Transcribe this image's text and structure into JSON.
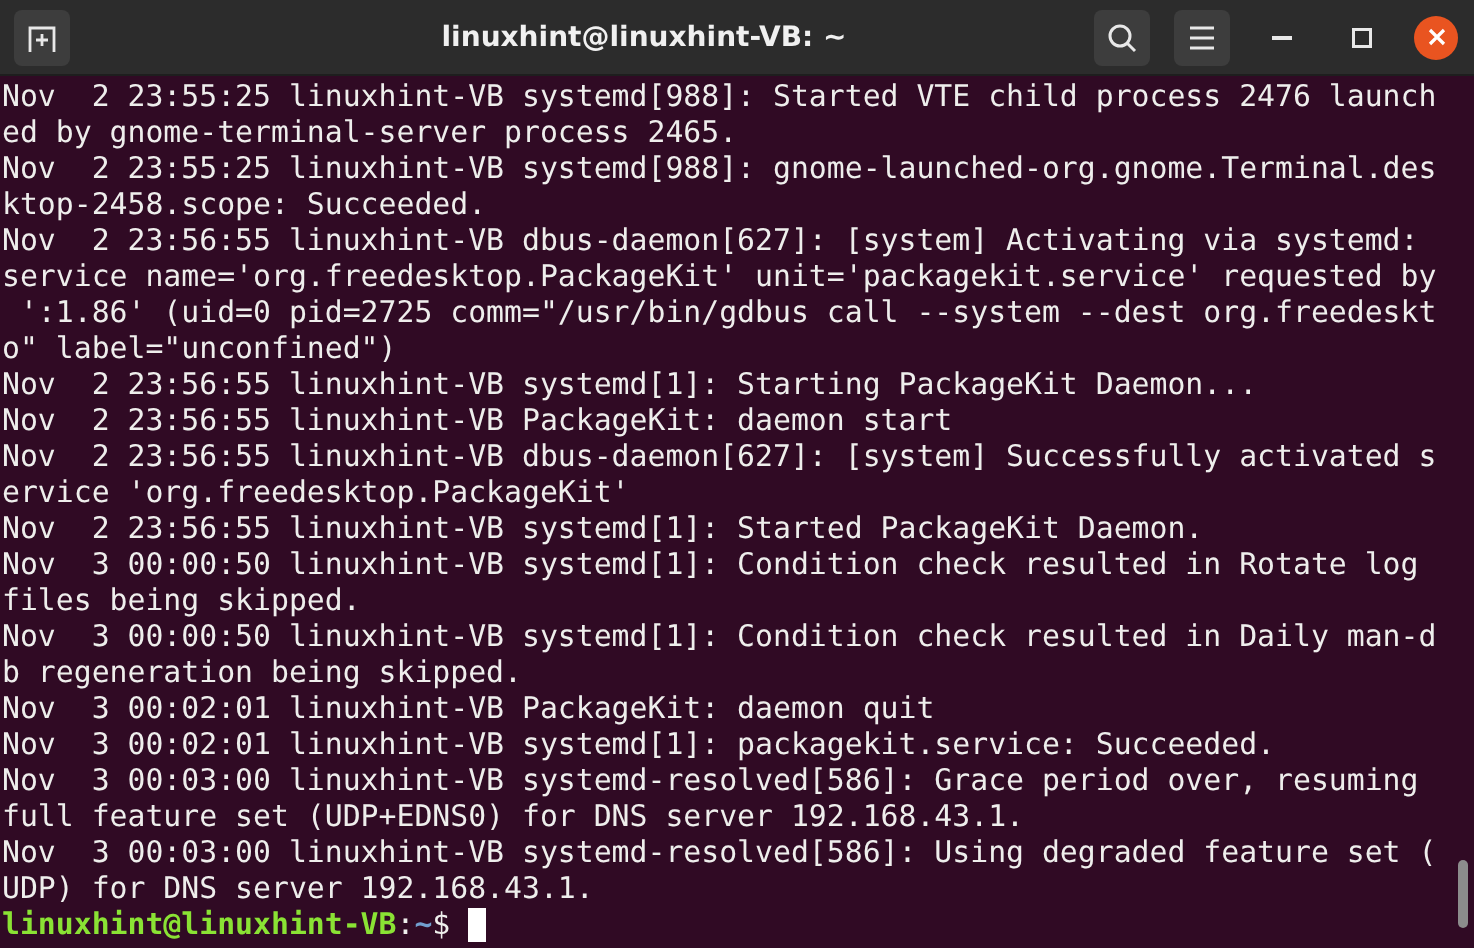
{
  "window": {
    "title": "linuxhint@linuxhint-VB: ~"
  },
  "output_lines": [
    "Nov  2 23:55:25 linuxhint-VB systemd[988]: Started VTE child process 2476 launch",
    "ed by gnome-terminal-server process 2465.",
    "Nov  2 23:55:25 linuxhint-VB systemd[988]: gnome-launched-org.gnome.Terminal.des",
    "ktop-2458.scope: Succeeded.",
    "Nov  2 23:56:55 linuxhint-VB dbus-daemon[627]: [system] Activating via systemd:",
    "service name='org.freedesktop.PackageKit' unit='packagekit.service' requested by",
    " ':1.86' (uid=0 pid=2725 comm=\"/usr/bin/gdbus call --system --dest org.freedeskt",
    "o\" label=\"unconfined\")",
    "Nov  2 23:56:55 linuxhint-VB systemd[1]: Starting PackageKit Daemon...",
    "Nov  2 23:56:55 linuxhint-VB PackageKit: daemon start",
    "Nov  2 23:56:55 linuxhint-VB dbus-daemon[627]: [system] Successfully activated s",
    "ervice 'org.freedesktop.PackageKit'",
    "Nov  2 23:56:55 linuxhint-VB systemd[1]: Started PackageKit Daemon.",
    "Nov  3 00:00:50 linuxhint-VB systemd[1]: Condition check resulted in Rotate log",
    "files being skipped.",
    "Nov  3 00:00:50 linuxhint-VB systemd[1]: Condition check resulted in Daily man-d",
    "b regeneration being skipped.",
    "Nov  3 00:02:01 linuxhint-VB PackageKit: daemon quit",
    "Nov  3 00:02:01 linuxhint-VB systemd[1]: packagekit.service: Succeeded.",
    "Nov  3 00:03:00 linuxhint-VB systemd-resolved[586]: Grace period over, resuming",
    "full feature set (UDP+EDNS0) for DNS server 192.168.43.1.",
    "Nov  3 00:03:00 linuxhint-VB systemd-resolved[586]: Using degraded feature set (",
    "UDP) for DNS server 192.168.43.1."
  ],
  "prompt": {
    "user_host": "linuxhint@linuxhint-VB",
    "separator": ":",
    "path": "~",
    "symbol": "$"
  }
}
